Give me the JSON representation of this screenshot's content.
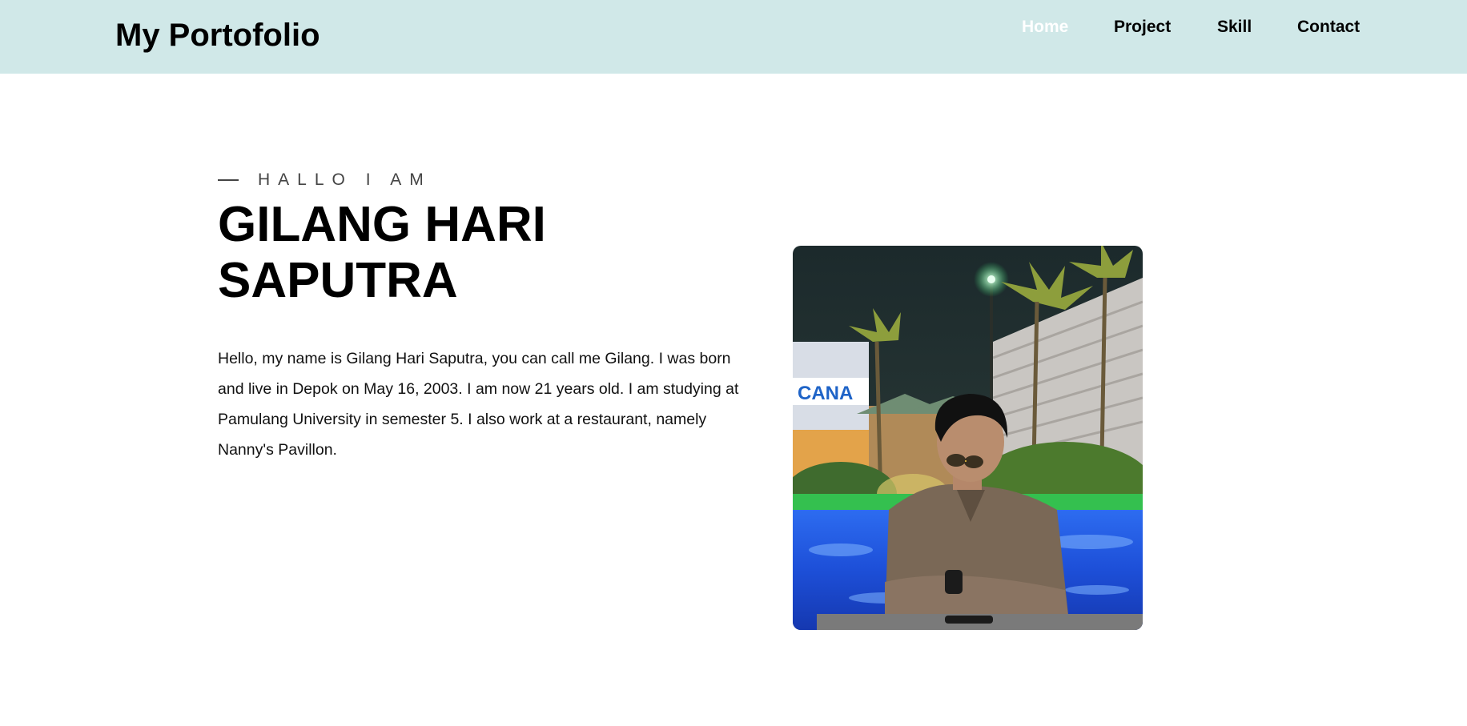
{
  "header": {
    "brand": "My Portofolio",
    "nav": [
      {
        "label": "Home",
        "active": true
      },
      {
        "label": "Project",
        "active": false
      },
      {
        "label": "Skill",
        "active": false
      },
      {
        "label": "Contact",
        "active": false
      }
    ]
  },
  "hero": {
    "eyebrow": "HALLO I AM",
    "name": "GILANG HARI SAPUTRA",
    "bio": "Hello, my name is Gilang Hari Saputra, you can call me Gilang. I was born and live in Depok on May 16, 2003. I am now 21 years old. I am studying at Pamulang University in semester 5. I also work at a restaurant, namely Nanny's Pavillon.",
    "photo_sign_text": "CANA"
  },
  "colors": {
    "header_bg": "#d0e8e8",
    "active_nav": "#ffffff",
    "text": "#000000"
  }
}
